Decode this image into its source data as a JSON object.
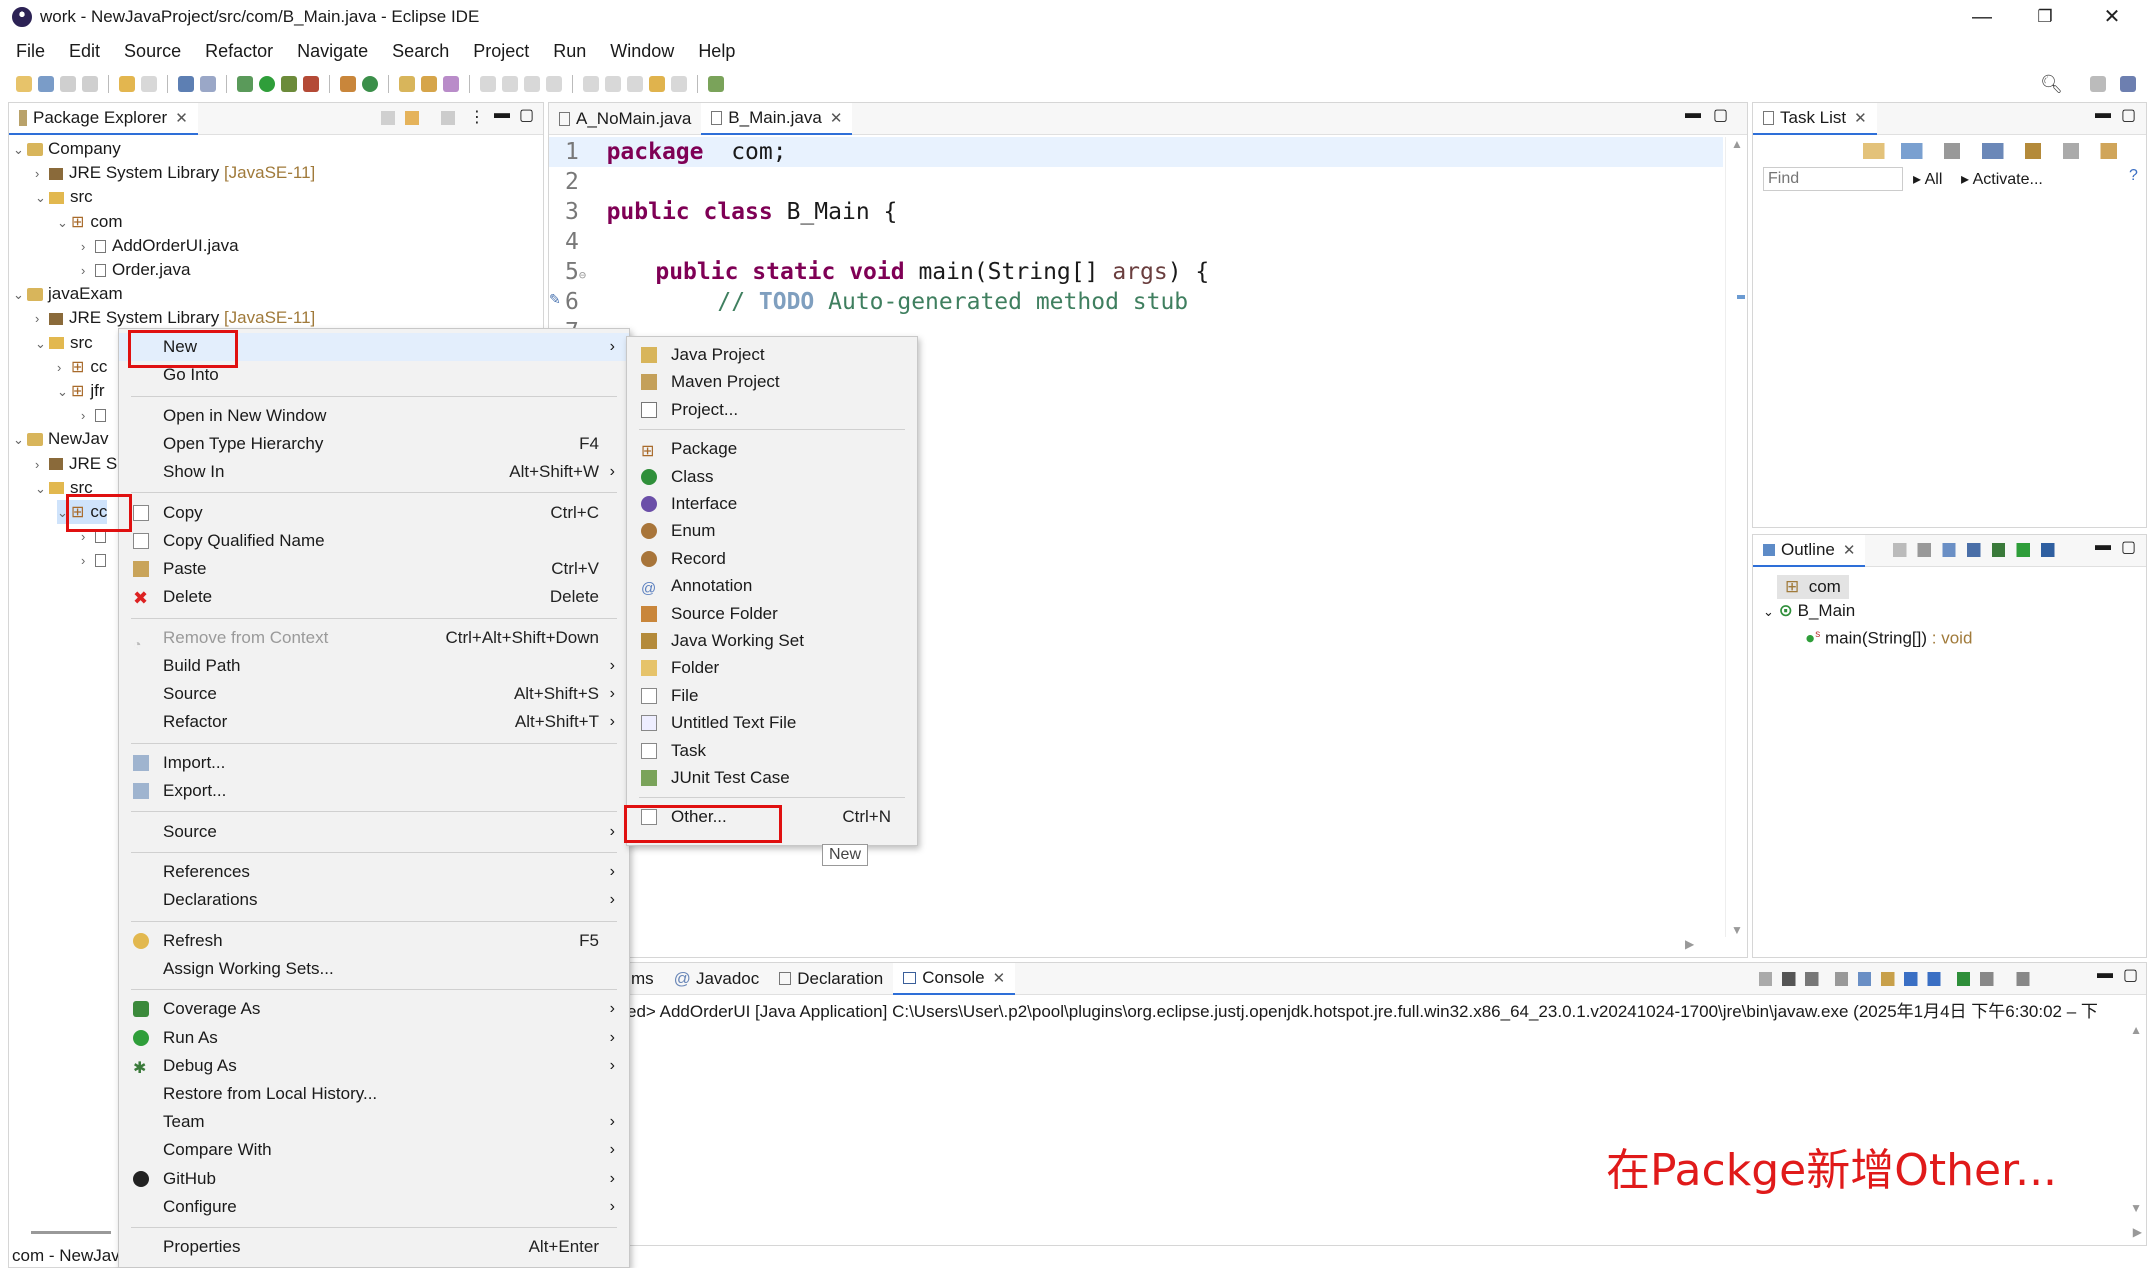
{
  "window": {
    "title": "work - NewJavaProject/src/com/B_Main.java - Eclipse IDE",
    "minimize": "—",
    "maximize": "❐",
    "close": "✕"
  },
  "menubar": [
    "File",
    "Edit",
    "Source",
    "Refactor",
    "Navigate",
    "Search",
    "Project",
    "Run",
    "Window",
    "Help"
  ],
  "package_explorer": {
    "tab_label": "Package Explorer",
    "rows": [
      {
        "text": "Company",
        "suffix": ""
      },
      {
        "text": "JRE System Library",
        "suffix": "[JavaSE-11]"
      },
      {
        "text": "src",
        "suffix": ""
      },
      {
        "text": "com",
        "suffix": ""
      },
      {
        "text": "AddOrderUI.java",
        "suffix": ""
      },
      {
        "text": "Order.java",
        "suffix": ""
      },
      {
        "text": "javaExam",
        "suffix": ""
      },
      {
        "text": "JRE System Library",
        "suffix": "[JavaSE-11]"
      },
      {
        "text": "src",
        "suffix": ""
      },
      {
        "text": "cc",
        "suffix": ""
      },
      {
        "text": "jfr",
        "suffix": ""
      },
      {
        "text": "",
        "suffix": ""
      },
      {
        "text": "NewJav",
        "suffix": ""
      },
      {
        "text": "JRE S",
        "suffix": ""
      },
      {
        "text": "src",
        "suffix": ""
      },
      {
        "text": "cc",
        "suffix": ""
      },
      {
        "text": "",
        "suffix": ""
      },
      {
        "text": "",
        "suffix": ""
      }
    ]
  },
  "editor": {
    "tabs": [
      "A_NoMain.java",
      "B_Main.java"
    ],
    "lines": [
      {
        "n": "1",
        "parts": [
          [
            "kw",
            "package"
          ],
          [
            "",
            "  com;"
          ]
        ]
      },
      {
        "n": "2",
        "parts": []
      },
      {
        "n": "3",
        "parts": [
          [
            "kw",
            "public class"
          ],
          [
            "",
            " B_Main {"
          ]
        ]
      },
      {
        "n": "4",
        "parts": []
      },
      {
        "n": "5",
        "parts": [
          [
            "",
            "    "
          ],
          [
            "kw",
            "public static void"
          ],
          [
            "",
            " main(String[] "
          ],
          [
            "arg",
            "args"
          ],
          [
            "",
            ") {"
          ]
        ]
      },
      {
        "n": "6",
        "parts": [
          [
            "",
            "        "
          ],
          [
            "cm",
            "// "
          ],
          [
            "todo",
            "TODO"
          ],
          [
            "cm",
            " Auto-generated method stub"
          ]
        ]
      },
      {
        "n": "7",
        "parts": []
      }
    ]
  },
  "task_list": {
    "tab_label": "Task List",
    "find_placeholder": "Find",
    "all_label": "All",
    "activate_label": "Activate..."
  },
  "outline": {
    "tab_label": "Outline",
    "items": [
      "com",
      "B_Main",
      "main(String[])",
      " : void"
    ]
  },
  "bottom": {
    "tabs": [
      "ms",
      "Javadoc",
      "Declaration",
      "Console"
    ],
    "console_line": "ed> AddOrderUI [Java Application] C:\\Users\\User\\.p2\\pool\\plugins\\org.eclipse.justj.openjdk.hotspot.jre.full.win32.x86_64_23.0.1.v20241024-1700\\jre\\bin\\javaw.exe  (2025年1月4日 下午6:30:02 – 下"
  },
  "status_bar": "com - NewJav",
  "context_menu": [
    {
      "label": "New",
      "shortcut": "",
      "sub": true,
      "icon": ""
    },
    {
      "label": "Go Into",
      "shortcut": "",
      "sub": false,
      "icon": ""
    },
    {
      "sep": true
    },
    {
      "label": "Open in New Window",
      "shortcut": "",
      "sub": false,
      "icon": ""
    },
    {
      "label": "Open Type Hierarchy",
      "shortcut": "F4",
      "sub": false,
      "icon": ""
    },
    {
      "label": "Show In",
      "shortcut": "Alt+Shift+W",
      "sub": true,
      "icon": ""
    },
    {
      "sep": true
    },
    {
      "label": "Copy",
      "shortcut": "Ctrl+C",
      "sub": false,
      "icon": "copy"
    },
    {
      "label": "Copy Qualified Name",
      "shortcut": "",
      "sub": false,
      "icon": "copy"
    },
    {
      "label": "Paste",
      "shortcut": "Ctrl+V",
      "sub": false,
      "icon": "paste"
    },
    {
      "label": "Delete",
      "shortcut": "Delete",
      "sub": false,
      "icon": "delete"
    },
    {
      "sep": true
    },
    {
      "label": "Remove from Context",
      "shortcut": "Ctrl+Alt+Shift+Down",
      "sub": false,
      "icon": "remove",
      "disabled": true
    },
    {
      "label": "Build Path",
      "shortcut": "",
      "sub": true,
      "icon": ""
    },
    {
      "label": "Source",
      "shortcut": "Alt+Shift+S",
      "sub": true,
      "icon": ""
    },
    {
      "label": "Refactor",
      "shortcut": "Alt+Shift+T",
      "sub": true,
      "icon": ""
    },
    {
      "sep": true
    },
    {
      "label": "Import...",
      "shortcut": "",
      "sub": false,
      "icon": "import"
    },
    {
      "label": "Export...",
      "shortcut": "",
      "sub": false,
      "icon": "export"
    },
    {
      "sep": true
    },
    {
      "label": "Source",
      "shortcut": "",
      "sub": true,
      "icon": ""
    },
    {
      "sep": true
    },
    {
      "label": "References",
      "shortcut": "",
      "sub": true,
      "icon": ""
    },
    {
      "label": "Declarations",
      "shortcut": "",
      "sub": true,
      "icon": ""
    },
    {
      "sep": true
    },
    {
      "label": "Refresh",
      "shortcut": "F5",
      "sub": false,
      "icon": "refresh"
    },
    {
      "label": "Assign Working Sets...",
      "shortcut": "",
      "sub": false,
      "icon": ""
    },
    {
      "sep": true
    },
    {
      "label": "Coverage As",
      "shortcut": "",
      "sub": true,
      "icon": "coverage"
    },
    {
      "label": "Run As",
      "shortcut": "",
      "sub": true,
      "icon": "run"
    },
    {
      "label": "Debug As",
      "shortcut": "",
      "sub": true,
      "icon": "debug"
    },
    {
      "label": "Restore from Local History...",
      "shortcut": "",
      "sub": false,
      "icon": ""
    },
    {
      "label": "Team",
      "shortcut": "",
      "sub": true,
      "icon": ""
    },
    {
      "label": "Compare With",
      "shortcut": "",
      "sub": true,
      "icon": ""
    },
    {
      "label": "GitHub",
      "shortcut": "",
      "sub": true,
      "icon": "github"
    },
    {
      "label": "Configure",
      "shortcut": "",
      "sub": true,
      "icon": ""
    },
    {
      "sep": true
    },
    {
      "label": "Properties",
      "shortcut": "Alt+Enter",
      "sub": false,
      "icon": ""
    }
  ],
  "submenu_new": [
    {
      "label": "Java Project",
      "icon": "javaproject",
      "shortcut": ""
    },
    {
      "label": "Maven Project",
      "icon": "maven",
      "shortcut": ""
    },
    {
      "label": "Project...",
      "icon": "project",
      "shortcut": ""
    },
    {
      "sep": true
    },
    {
      "label": "Package",
      "icon": "package",
      "shortcut": ""
    },
    {
      "label": "Class",
      "icon": "class",
      "shortcut": ""
    },
    {
      "label": "Interface",
      "icon": "interface",
      "shortcut": ""
    },
    {
      "label": "Enum",
      "icon": "enum",
      "shortcut": ""
    },
    {
      "label": "Record",
      "icon": "record",
      "shortcut": ""
    },
    {
      "label": "Annotation",
      "icon": "annotation",
      "shortcut": ""
    },
    {
      "label": "Source Folder",
      "icon": "sourcefolder",
      "shortcut": ""
    },
    {
      "label": "Java Working Set",
      "icon": "workingset",
      "shortcut": ""
    },
    {
      "label": "Folder",
      "icon": "folder",
      "shortcut": ""
    },
    {
      "label": "File",
      "icon": "file",
      "shortcut": ""
    },
    {
      "label": "Untitled Text File",
      "icon": "textfile",
      "shortcut": ""
    },
    {
      "label": "Task",
      "icon": "task",
      "shortcut": ""
    },
    {
      "label": "JUnit Test Case",
      "icon": "junit",
      "shortcut": ""
    },
    {
      "sep": true
    },
    {
      "label": "Other...",
      "icon": "other",
      "shortcut": "Ctrl+N"
    }
  ],
  "tooltip": "New",
  "annotation_caption": "在Packge新增Other...",
  "colors": {
    "highlight_box": "#e01010",
    "caption": "#e01a1a",
    "keyword": "#7f0055",
    "comment": "#3f7f5f"
  }
}
